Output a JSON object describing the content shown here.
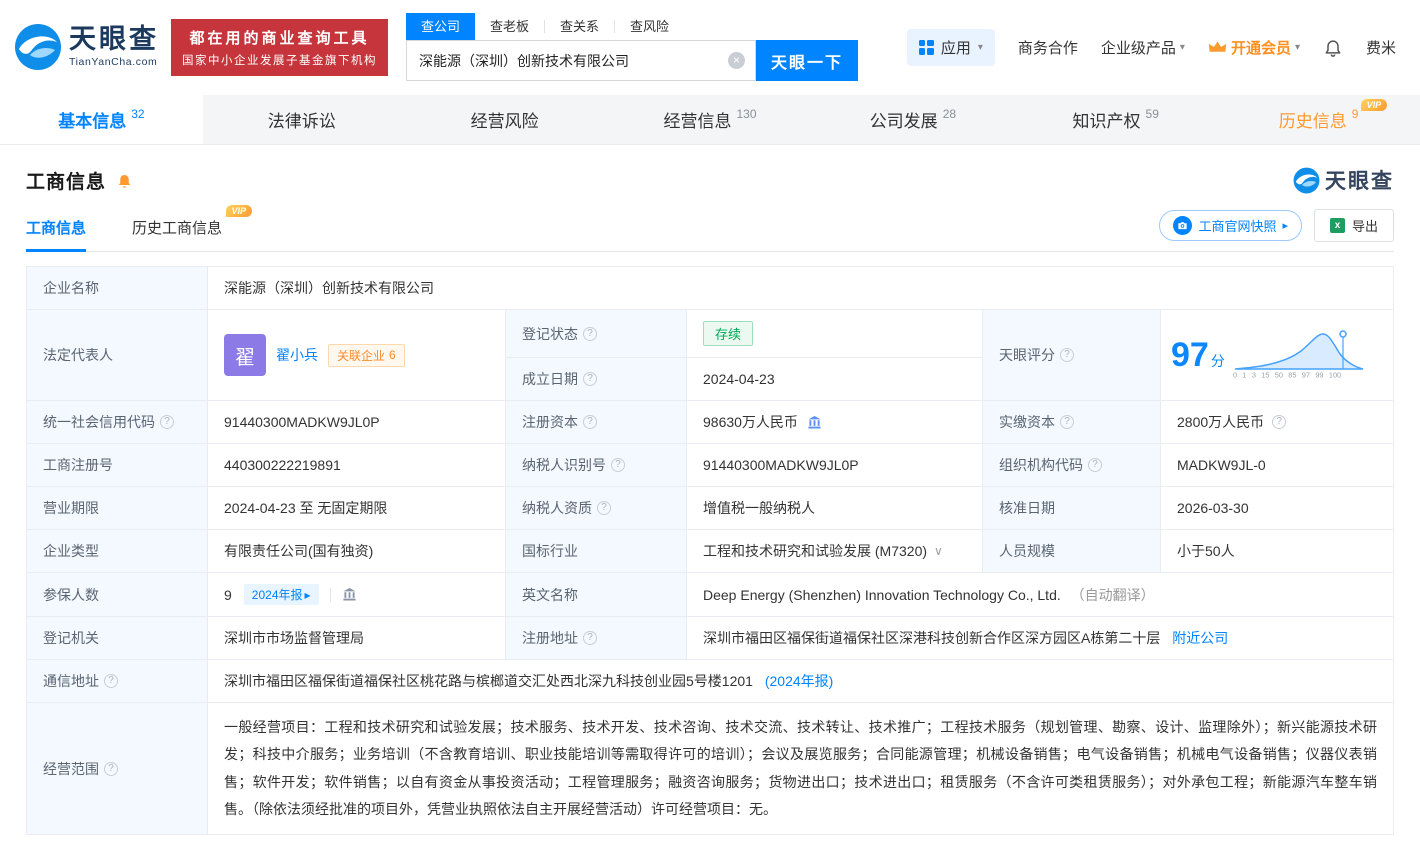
{
  "icons": {
    "help": "?",
    "clear": "×",
    "caret_down": "▾",
    "arrow_right": "▸",
    "dropdown": "∨"
  },
  "header": {
    "logo": {
      "brand": "天眼查",
      "domain": "TianYanCha.com"
    },
    "promo": {
      "line1": "都在用的商业查询工具",
      "line2": "国家中小企业发展子基金旗下机构"
    },
    "search": {
      "tabs": [
        {
          "label": "查公司"
        },
        {
          "label": "查老板"
        },
        {
          "label": "查关系"
        },
        {
          "label": "查风险"
        }
      ],
      "value": "深能源（深圳）创新技术有限公司",
      "button_label": "天眼一下"
    },
    "menu": {
      "apps": "应用",
      "cooperation": "商务合作",
      "enterprise": "企业级产品",
      "vip": "开通会员",
      "username": "费米"
    }
  },
  "nav": {
    "vip_tag": "VIP",
    "tabs": [
      {
        "label": "基本信息",
        "count": "32"
      },
      {
        "label": "法律诉讼",
        "count": ""
      },
      {
        "label": "经营风险",
        "count": ""
      },
      {
        "label": "经营信息",
        "count": "130"
      },
      {
        "label": "公司发展",
        "count": "28"
      },
      {
        "label": "知识产权",
        "count": "59"
      },
      {
        "label": "历史信息",
        "count": "9"
      }
    ]
  },
  "section": {
    "title": "工商信息",
    "brand": "天眼查"
  },
  "subnav": {
    "vip_tag": "VIP",
    "tabs": [
      {
        "label": "工商信息"
      },
      {
        "label": "历史工商信息"
      }
    ],
    "snapshot_label": "工商官网快照",
    "export_label": "导出"
  },
  "info": {
    "company_name": {
      "label": "企业名称",
      "value": "深能源（深圳）创新技术有限公司"
    },
    "legal_rep": {
      "label": "法定代表人",
      "avatar": "翟",
      "name": "翟小兵",
      "related_label": "关联企业",
      "related_count": "6"
    },
    "reg_status": {
      "label": "登记状态",
      "value": "存续"
    },
    "establish_date": {
      "label": "成立日期",
      "value": "2024-04-23"
    },
    "score": {
      "label": "天眼评分",
      "value": "97",
      "unit": "分",
      "axis_labels": [
        "0",
        "1",
        "3",
        "15",
        "50",
        "85",
        "97",
        "99",
        "100"
      ]
    },
    "credit_code": {
      "label": "统一社会信用代码",
      "value": "91440300MADKW9JL0P"
    },
    "reg_capital": {
      "label": "注册资本",
      "value": "98630万人民币"
    },
    "paid_capital": {
      "label": "实缴资本",
      "value": "2800万人民币"
    },
    "reg_number": {
      "label": "工商注册号",
      "value": "440300222219891"
    },
    "taxpayer_id": {
      "label": "纳税人识别号",
      "value": "91440300MADKW9JL0P"
    },
    "org_code": {
      "label": "组织机构代码",
      "value": "MADKW9JL-0"
    },
    "business_term": {
      "label": "营业期限",
      "value": "2024-04-23 至 无固定期限"
    },
    "taxpayer_quality": {
      "label": "纳税人资质",
      "value": "增值税一般纳税人"
    },
    "approval_date": {
      "label": "核准日期",
      "value": "2026-03-30"
    },
    "company_type": {
      "label": "企业类型",
      "value": "有限责任公司(国有独资)"
    },
    "industry": {
      "label": "国标行业",
      "value": "工程和技术研究和试验发展 (M7320)"
    },
    "staff_size": {
      "label": "人员规模",
      "value": "小于50人"
    },
    "insured": {
      "label": "参保人数",
      "value": "9",
      "badge": "2024年报"
    },
    "english_name": {
      "label": "英文名称",
      "value": "Deep Energy (Shenzhen) Innovation Technology Co., Ltd.",
      "note": "（自动翻译）"
    },
    "reg_authority": {
      "label": "登记机关",
      "value": "深圳市市场监督管理局"
    },
    "reg_address": {
      "label": "注册地址",
      "value": "深圳市福田区福保街道福保社区深港科技创新合作区深方园区A栋第二十层",
      "link": "附近公司"
    },
    "mail_address": {
      "label": "通信地址",
      "value": "深圳市福田区福保街道福保社区桃花路与槟榔道交汇处西北深九科技创业园5号楼1201",
      "link": "(2024年报)"
    },
    "business_scope": {
      "label": "经营范围",
      "value": "一般经营项目：工程和技术研究和试验发展；技术服务、技术开发、技术咨询、技术交流、技术转让、技术推广；工程技术服务（规划管理、勘察、设计、监理除外）；新兴能源技术研发；科技中介服务；业务培训（不含教育培训、职业技能培训等需取得许可的培训）；会议及展览服务；合同能源管理；机械设备销售；电气设备销售；机械电气设备销售；仪器仪表销售；软件开发；软件销售；以自有资金从事投资活动；工程管理服务；融资咨询服务；货物进出口；技术进出口；租赁服务（不含许可类租赁服务）；对外承包工程；新能源汽车整车销售。（除依法须经批准的项目外，凭营业执照依法自主开展经营活动）许可经营项目：无。"
    }
  },
  "colors": {
    "brand_blue": "#0084ff",
    "promo_red": "#c5353b",
    "vip_orange": "#ff9a2e",
    "status_green": "#00a854",
    "label_bg": "#f3f9fe"
  }
}
